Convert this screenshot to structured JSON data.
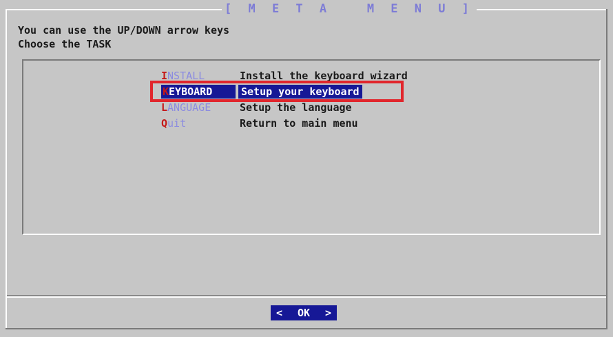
{
  "dialog": {
    "title": "[ M E T A   M E N U ]",
    "prompt_line1": "You can use the UP/DOWN arrow keys",
    "prompt_line2": "Choose the TASK"
  },
  "menu": {
    "items": [
      {
        "hotkey": "I",
        "tag_rest": "NSTALL",
        "description": "Install the keyboard wizard",
        "selected": false
      },
      {
        "hotkey": "K",
        "tag_rest": "EYBOARD",
        "description": "Setup your keyboard",
        "selected": true
      },
      {
        "hotkey": "L",
        "tag_rest": "ANGUAGE",
        "description": "Setup the language",
        "selected": false
      },
      {
        "hotkey": "Q",
        "tag_rest": "uit",
        "description": "Return to main menu",
        "selected": false
      }
    ]
  },
  "buttons": {
    "left_arrow": "<",
    "ok_label": "OK",
    "right_arrow": ">"
  },
  "colors": {
    "background": "#c6c6c6",
    "selection": "#161896",
    "hotkey": "#c41818",
    "tag_text": "#8c8ce0",
    "annotation_box": "#e1262c"
  }
}
